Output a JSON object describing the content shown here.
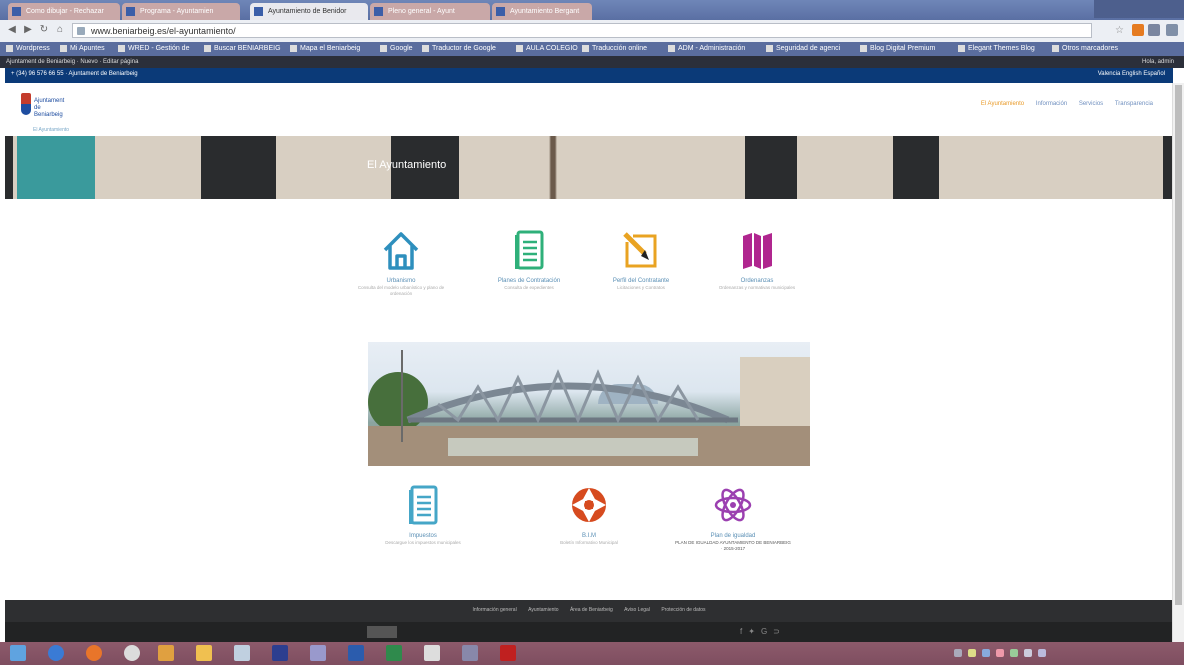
{
  "browser": {
    "tabs": [
      {
        "label": "Como dibujar - Rechazar",
        "active": false
      },
      {
        "label": "Programa - Ayuntamien",
        "active": false
      },
      {
        "label": "Ayuntamiento de Benidor",
        "active": true
      },
      {
        "label": "Pleno general - Ayunt",
        "active": false
      },
      {
        "label": "Ayuntamiento Bergant",
        "active": false
      }
    ],
    "url": "www.beniarbeig.es/el-ayuntamiento/",
    "bookmarks": [
      "Wordpress",
      "Mi Apuntes",
      "WRED - Gestión de",
      "Buscar BENIARBEIG",
      "Mapa el Beniarbeig",
      "Google",
      "Traductor de Google",
      "AULA COLEGIO",
      "Traducción online",
      "ADM - Administración",
      "Seguridad de agenci",
      "Blog Digital Premium",
      "Elegant Themes Blog",
      "Otros marcadores"
    ]
  },
  "site": {
    "top_left": "+ (34) 96 576 66 55 · Ajuntament de Beniarbeig",
    "top_right": "Valencia English Español",
    "logo_text": "Ajuntament de Beniarbeig",
    "nav": [
      "El Ayuntamiento",
      "Información",
      "Servicios",
      "Transparencia"
    ],
    "breadcrumb": "El Ayuntamiento",
    "hero_title": "El Ayuntamiento",
    "icons": [
      {
        "title": "Urbanismo",
        "desc": "Consulta del modelo urbanístico y plano de ordenación",
        "icon": "home-icon",
        "color": "#2e8fbd"
      },
      {
        "title": "Planes de Contratación",
        "desc": "Consulta de expedientes",
        "icon": "document-icon",
        "color": "#2fb07a"
      },
      {
        "title": "Perfil del Contratante",
        "desc": "Licitaciones y Contratos",
        "icon": "pencil-icon",
        "color": "#e9a322"
      },
      {
        "title": "Ordenanzas",
        "desc": "Ordenanzas y normativas municipales",
        "icon": "map-icon",
        "color": "#b0268f"
      }
    ],
    "bottom": [
      {
        "title": "Impuestos",
        "desc": "Descargue los impuestos municipales",
        "icon": "document-icon",
        "color": "#45a6c7"
      },
      {
        "title": "B.I.M",
        "desc": "Boletín Informativo Municipal",
        "icon": "aperture-icon",
        "color": "#d64b1f"
      },
      {
        "title": "Plan de igualdad",
        "desc": "PLAN DE IGUALDAD AYUNTAMIENTO DE BENIARBEIG · 2015-2017",
        "icon": "atom-icon",
        "color": "#9b3fb0"
      }
    ],
    "footer_links": [
      "Información general",
      "Ayuntamiento",
      "Área de Beniarbeig",
      "Aviso Legal",
      "Protección de datos"
    ]
  }
}
